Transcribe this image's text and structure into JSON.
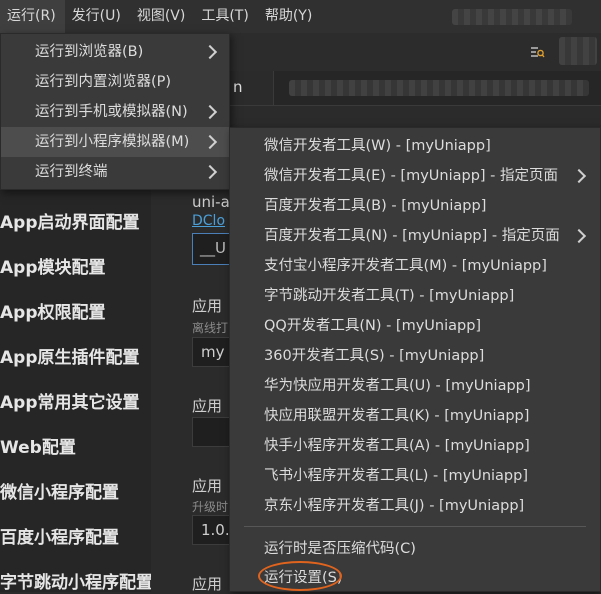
{
  "menubar": {
    "items": [
      "运行(R)",
      "发行(U)",
      "视图(V)",
      "工具(T)",
      "帮助(Y)"
    ]
  },
  "editor": {
    "active_tab": "n"
  },
  "sidebar": {
    "items": [
      "App启动界面配置",
      "App模块配置",
      "App权限配置",
      "App原生插件配置",
      "App常用其它设置",
      "Web配置",
      "微信小程序配置",
      "百度小程序配置",
      "字节跳动小程序配置"
    ]
  },
  "content": {
    "fragment_uni": "uni-a",
    "fragment_dclo": "DClo",
    "fragment_u": "__U",
    "fragment_app1": "应用",
    "fragment_hint1": "离线打",
    "fragment_my": "my",
    "fragment_app2": "应用",
    "fragment_app3": "应用",
    "fragment_hint2": "升级时",
    "fragment_version": "1.0.",
    "fragment_app4": "应用"
  },
  "run_menu": {
    "items": [
      {
        "label": "运行到浏览器(B)",
        "submenu": true
      },
      {
        "label": "运行到内置浏览器(P)",
        "submenu": false
      },
      {
        "label": "运行到手机或模拟器(N)",
        "submenu": true
      },
      {
        "label": "运行到小程序模拟器(M)",
        "submenu": true
      },
      {
        "label": "运行到终端",
        "submenu": true
      }
    ]
  },
  "sub_menu": {
    "items": [
      {
        "label": "微信开发者工具(W) - [myUniapp]",
        "submenu": false
      },
      {
        "label": "微信开发者工具(E) - [myUniapp] - 指定页面",
        "submenu": true
      },
      {
        "label": "百度开发者工具(B) - [myUniapp]",
        "submenu": false
      },
      {
        "label": "百度开发者工具(N) - [myUniapp] - 指定页面",
        "submenu": true
      },
      {
        "label": "支付宝小程序开发者工具(M) - [myUniapp]",
        "submenu": false
      },
      {
        "label": "字节跳动开发者工具(T) - [myUniapp]",
        "submenu": false
      },
      {
        "label": "QQ开发者工具(N) - [myUniapp]",
        "submenu": false
      },
      {
        "label": "360开发者工具(S) - [myUniapp]",
        "submenu": false
      },
      {
        "label": "华为快应用开发者工具(U) - [myUniapp]",
        "submenu": false
      },
      {
        "label": "快应用联盟开发者工具(K) - [myUniapp]",
        "submenu": false
      },
      {
        "label": "快手小程序开发者工具(A) - [myUniapp]",
        "submenu": false
      },
      {
        "label": "飞书小程序开发者工具(L) - [myUniapp]",
        "submenu": false
      },
      {
        "label": "京东小程序开发者工具(J) - [myUniapp]",
        "submenu": false
      }
    ],
    "footer": [
      "运行时是否压缩代码(C)",
      "运行设置(S)"
    ]
  },
  "colors": {
    "highlight_annotation": "#e0641e",
    "link": "#4a9fd8"
  }
}
